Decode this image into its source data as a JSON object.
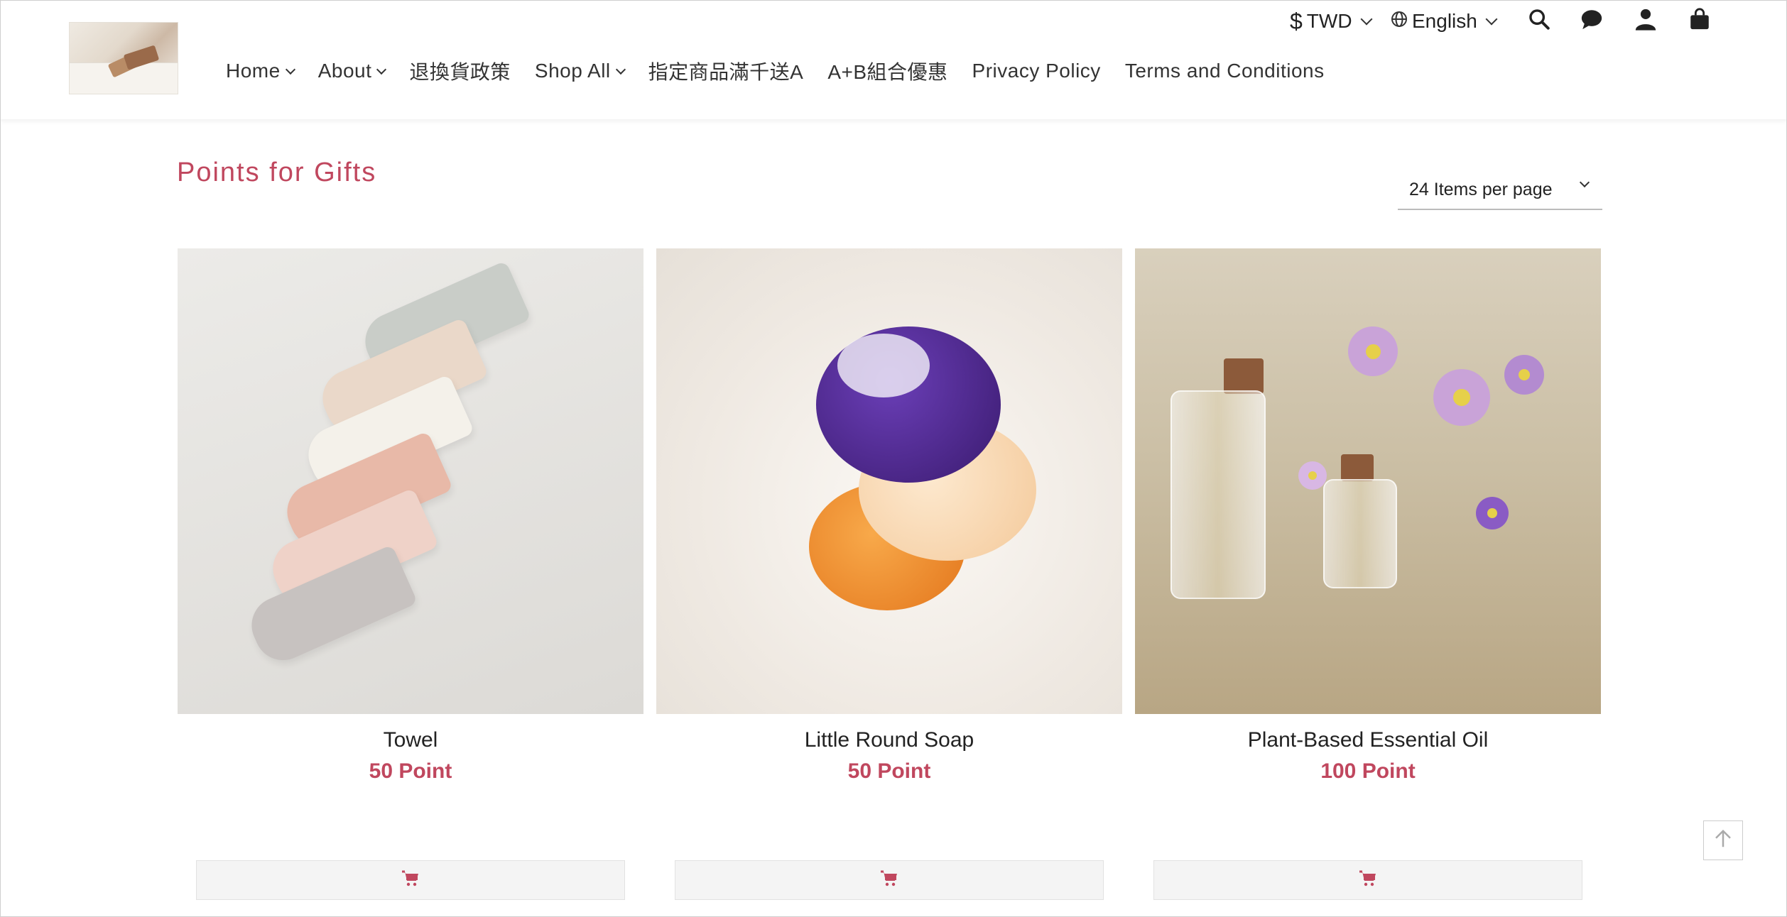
{
  "header": {
    "currency_label": "TWD",
    "language_label": "English",
    "nav": [
      {
        "label": "Home",
        "has_dropdown": true
      },
      {
        "label": "About",
        "has_dropdown": true
      },
      {
        "label": "退換貨政策",
        "has_dropdown": false
      },
      {
        "label": "Shop All",
        "has_dropdown": true
      },
      {
        "label": "指定商品滿千送A",
        "has_dropdown": false
      },
      {
        "label": "A+B組合優惠",
        "has_dropdown": false
      },
      {
        "label": "Privacy Policy",
        "has_dropdown": false
      },
      {
        "label": "Terms and Conditions",
        "has_dropdown": false
      }
    ],
    "icons": [
      "globe-icon",
      "search-icon",
      "chat-icon",
      "user-icon",
      "shopping-bag-icon"
    ]
  },
  "main": {
    "title": "Points for Gifts",
    "per_page": "24 Items per page",
    "products": [
      {
        "name": "Towel",
        "price": "50 Point"
      },
      {
        "name": "Little Round Soap",
        "price": "50 Point"
      },
      {
        "name": "Plant-Based Essential Oil",
        "price": "100 Point"
      }
    ]
  },
  "colors": {
    "accent": "#c0475e",
    "text": "#333333"
  }
}
